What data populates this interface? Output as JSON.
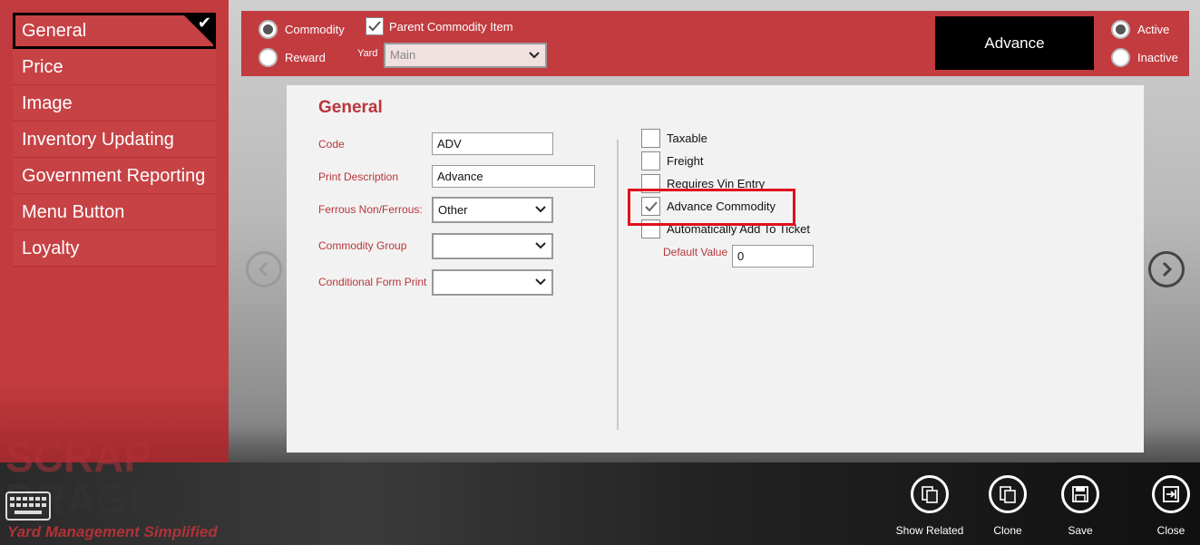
{
  "sidebar": {
    "items": [
      {
        "label": "General",
        "selected": true
      },
      {
        "label": "Price"
      },
      {
        "label": "Image"
      },
      {
        "label": "Inventory Updating"
      },
      {
        "label": "Government Reporting"
      },
      {
        "label": "Menu Button"
      },
      {
        "label": "Loyalty"
      }
    ]
  },
  "topbar": {
    "type_options": [
      "Commodity",
      "Reward"
    ],
    "type_selected": "Commodity",
    "parent_item_label": "Parent Commodity Item",
    "parent_item_checked": true,
    "yard_label": "Yard",
    "yard_value": "Main",
    "title_box": "Advance",
    "status_options": [
      "Active",
      "Inactive"
    ],
    "status_selected": "Active"
  },
  "general": {
    "title": "General",
    "code_label": "Code",
    "code_value": "ADV",
    "print_desc_label": "Print Description",
    "print_desc_value": "Advance",
    "ferrous_label": "Ferrous Non/Ferrous:",
    "ferrous_value": "Other",
    "commodity_group_label": "Commodity Group",
    "commodity_group_value": "",
    "conditional_form_label": "Conditional Form Print",
    "conditional_form_value": "",
    "checks": [
      {
        "label": "Taxable",
        "checked": false
      },
      {
        "label": "Freight",
        "checked": false
      },
      {
        "label": "Requires Vin Entry",
        "checked": false
      },
      {
        "label": "Advance Commodity",
        "checked": true
      },
      {
        "label": "Automatically Add To Ticket",
        "checked": false
      }
    ],
    "default_value_label": "Default Value",
    "default_value": "0"
  },
  "logo": {
    "line1": "SCRAP",
    "line2": "DRAGON",
    "tagline": "Yard Management Simplified"
  },
  "actions": {
    "show_related": "Show Related",
    "clone": "Clone",
    "save": "Save",
    "close": "Close"
  },
  "colors": {
    "accent": "#c23b3f",
    "label_red": "#b8363b",
    "highlight": "#e0101c"
  }
}
